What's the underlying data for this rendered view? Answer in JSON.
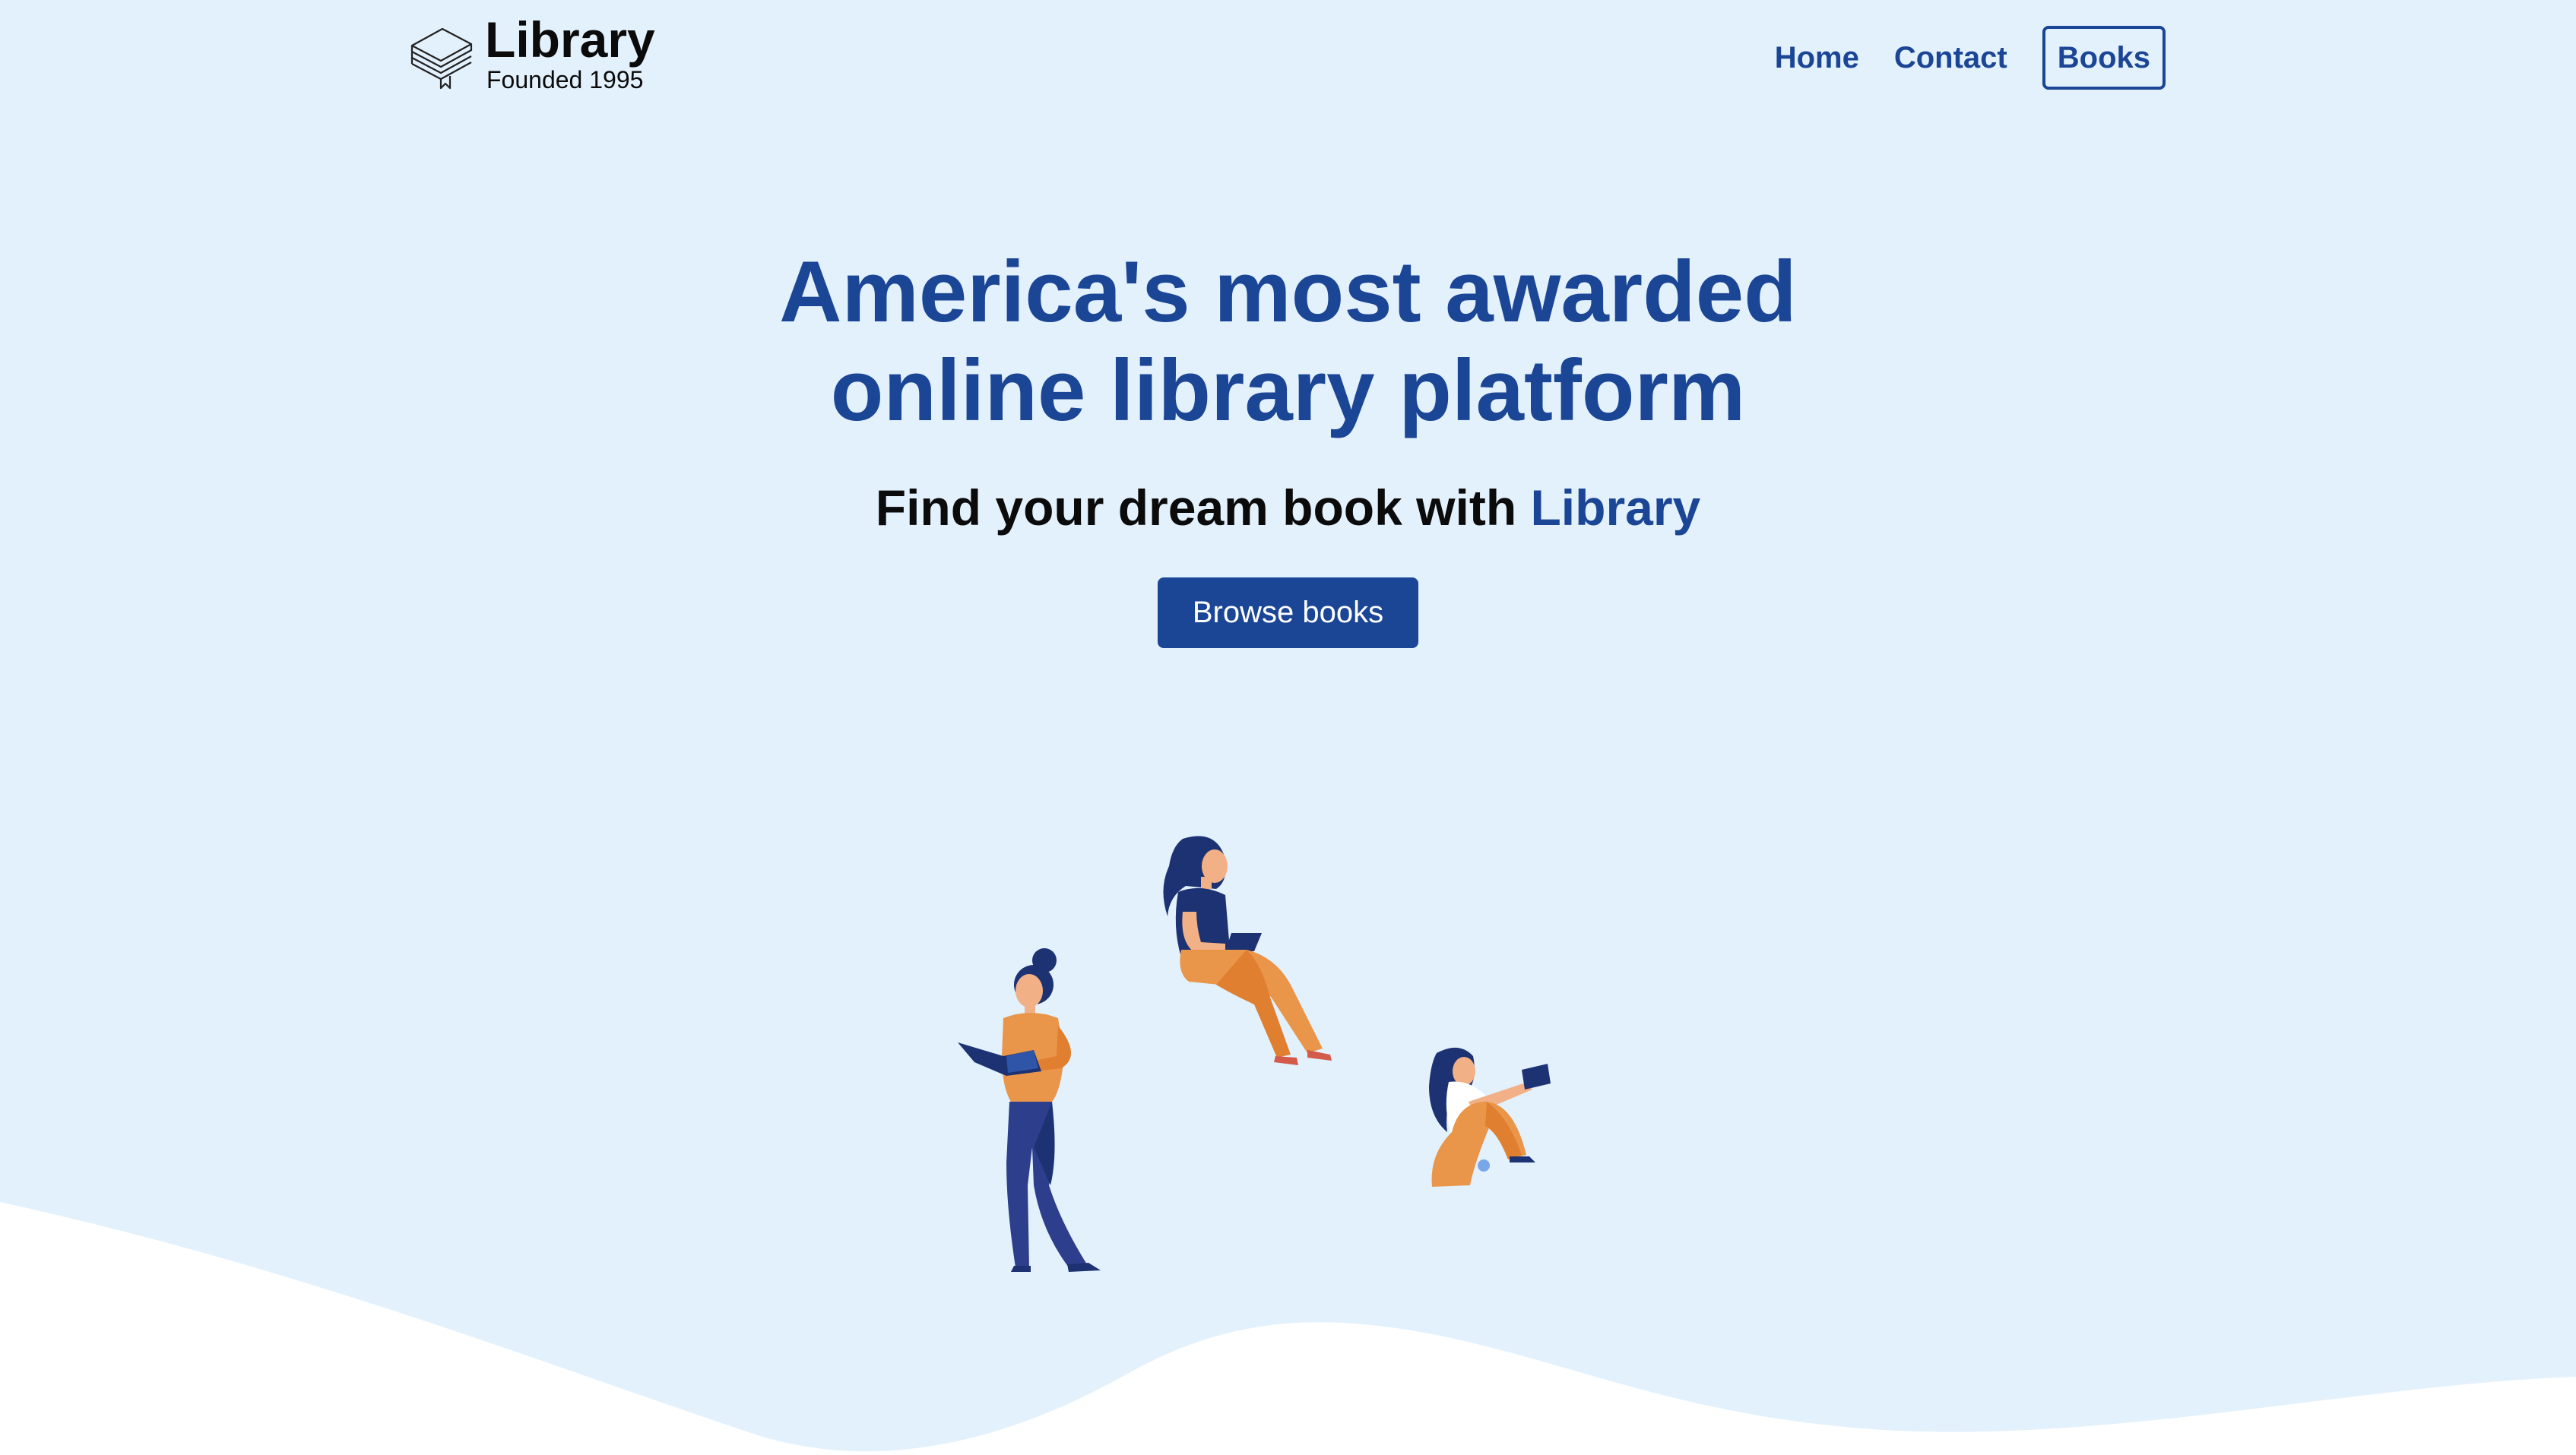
{
  "header": {
    "logo": {
      "name": "Library",
      "tagline": "Founded 1995",
      "icon": "stacked-books-icon"
    },
    "nav": [
      {
        "label": "Home",
        "active": false
      },
      {
        "label": "Contact",
        "active": false
      },
      {
        "label": "Books",
        "active": true
      }
    ]
  },
  "hero": {
    "title_line1": "America's most awarded",
    "title_line2": "online library platform",
    "subtitle_prefix": "Find your dream book with ",
    "subtitle_brand": "Library",
    "cta_label": "Browse books"
  },
  "colors": {
    "background": "#e3f1fd",
    "primary": "#1b4595",
    "text": "#0b0b0b",
    "accent_orange": "#e9954a",
    "navy": "#1d3272",
    "wave": "#ffffff"
  }
}
